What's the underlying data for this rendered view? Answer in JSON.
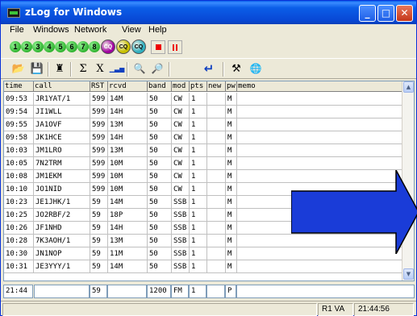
{
  "window": {
    "title": "zLog for Windows"
  },
  "menu": [
    "File",
    "Windows",
    "Network",
    "View",
    "Help"
  ],
  "toolbar1": {
    "numbers": [
      "1",
      "2",
      "3",
      "4",
      "5",
      "6",
      "7",
      "8"
    ],
    "cq_buttons": [
      {
        "label": "CQ",
        "color": "#a000a0"
      },
      {
        "label": "CQ",
        "color": "#c8c000"
      },
      {
        "label": "CQ",
        "color": "#30b0c0"
      }
    ]
  },
  "toolbar2": {
    "tools": [
      {
        "name": "open-icon",
        "glyph": "📂"
      },
      {
        "name": "save-icon",
        "glyph": "💾"
      },
      {
        "name": "person-icon",
        "glyph": "♜"
      },
      {
        "name": "sum-icon",
        "glyph": "Σ"
      },
      {
        "name": "multiply-icon",
        "glyph": "X"
      },
      {
        "name": "chart-icon",
        "glyph": "▁▃▅"
      },
      {
        "name": "zoom-in-icon",
        "glyph": "🔍"
      },
      {
        "name": "zoom-out-icon",
        "glyph": "🔎"
      },
      {
        "name": "enter-arrow-icon",
        "glyph": "↵"
      },
      {
        "name": "tools-icon",
        "glyph": "⚒"
      },
      {
        "name": "globe-icon",
        "glyph": "🌐"
      }
    ]
  },
  "columns": [
    "time",
    "call",
    "RST",
    "rcvd",
    "band",
    "mod",
    "pts",
    "new",
    "pwr",
    "memo"
  ],
  "rows": [
    [
      "09:53",
      "JR1YAT/1",
      "599",
      "14M",
      "50",
      "CW",
      "1",
      "",
      "M",
      ""
    ],
    [
      "09:54",
      "JI1WLL",
      "599",
      "14H",
      "50",
      "CW",
      "1",
      "",
      "M",
      ""
    ],
    [
      "09:55",
      "JA1OVF",
      "599",
      "13M",
      "50",
      "CW",
      "1",
      "",
      "M",
      ""
    ],
    [
      "09:58",
      "JK1HCE",
      "599",
      "14H",
      "50",
      "CW",
      "1",
      "",
      "M",
      ""
    ],
    [
      "10:03",
      "JM1LRO",
      "599",
      "13M",
      "50",
      "CW",
      "1",
      "",
      "M",
      ""
    ],
    [
      "10:05",
      "7N2TRM",
      "599",
      "10M",
      "50",
      "CW",
      "1",
      "",
      "M",
      ""
    ],
    [
      "10:08",
      "JM1EKM",
      "599",
      "10M",
      "50",
      "CW",
      "1",
      "",
      "M",
      ""
    ],
    [
      "10:10",
      "JO1NID",
      "599",
      "10M",
      "50",
      "CW",
      "1",
      "",
      "M",
      ""
    ],
    [
      "10:23",
      "JE1JHK/1",
      "59",
      "14M",
      "50",
      "SSB",
      "1",
      "",
      "M",
      ""
    ],
    [
      "10:25",
      "JO2RBF/2",
      "59",
      "18P",
      "50",
      "SSB",
      "1",
      "",
      "M",
      ""
    ],
    [
      "10:26",
      "JF1NHD",
      "59",
      "14H",
      "50",
      "SSB",
      "1",
      "",
      "M",
      ""
    ],
    [
      "10:28",
      "7K3AOH/1",
      "59",
      "13M",
      "50",
      "SSB",
      "1",
      "",
      "M",
      ""
    ],
    [
      "10:30",
      "JN1NOP",
      "59",
      "11M",
      "50",
      "SSB",
      "1",
      "",
      "M",
      ""
    ],
    [
      "10:31",
      "JE3YYY/1",
      "59",
      "14M",
      "50",
      "SSB",
      "1",
      "",
      "M",
      ""
    ]
  ],
  "entry": {
    "time": "21:44",
    "call": "",
    "rst": "59",
    "rcvd": "",
    "band": "1200",
    "mode": "FM",
    "pts": "1",
    "new": "",
    "pwr": "P",
    "memo": ""
  },
  "status": {
    "rig": "R1 VA",
    "clock": "21:44:56"
  },
  "colors": {
    "arrow": "#1a3cd8",
    "title_bar": "#0a5fea"
  }
}
